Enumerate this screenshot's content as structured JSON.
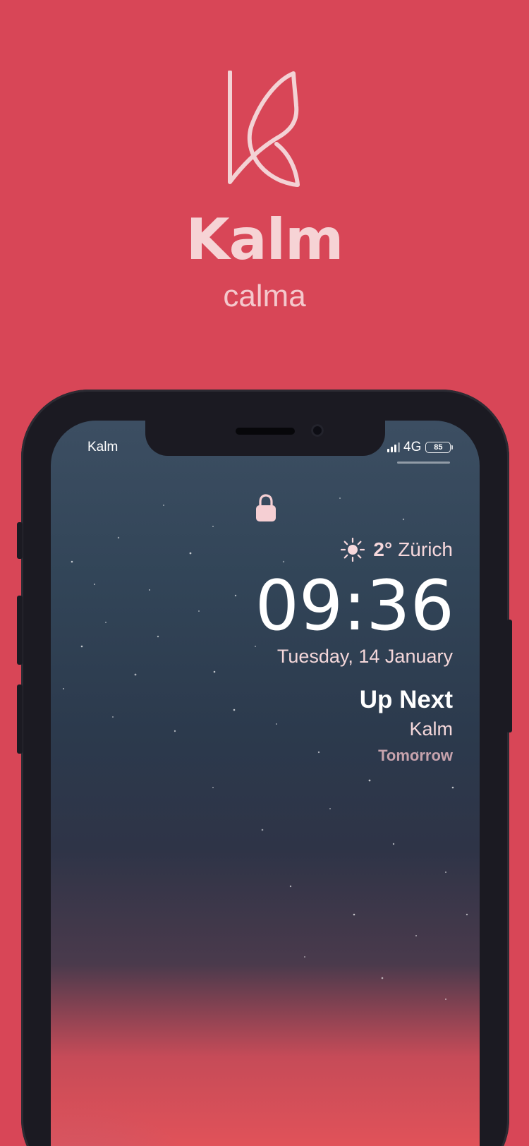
{
  "brand": {
    "name": "Kalm",
    "tagline": "calma",
    "logo_icon": "leaf-k-logo"
  },
  "colors": {
    "background": "#d84657",
    "brand_text": "#f6d3d5",
    "phone_frame": "#1b1a22"
  },
  "status_bar": {
    "app_label": "Kalm",
    "network": "4G",
    "battery": "85"
  },
  "lock_screen": {
    "lock_icon": "lock-icon",
    "weather": {
      "icon": "sun-icon",
      "temperature": "2°",
      "city": "Zürich"
    },
    "time": "09:36",
    "date": "Tuesday, 14 January",
    "up_next": {
      "heading": "Up Next",
      "app": "Kalm",
      "when": "Tomorrow"
    }
  }
}
